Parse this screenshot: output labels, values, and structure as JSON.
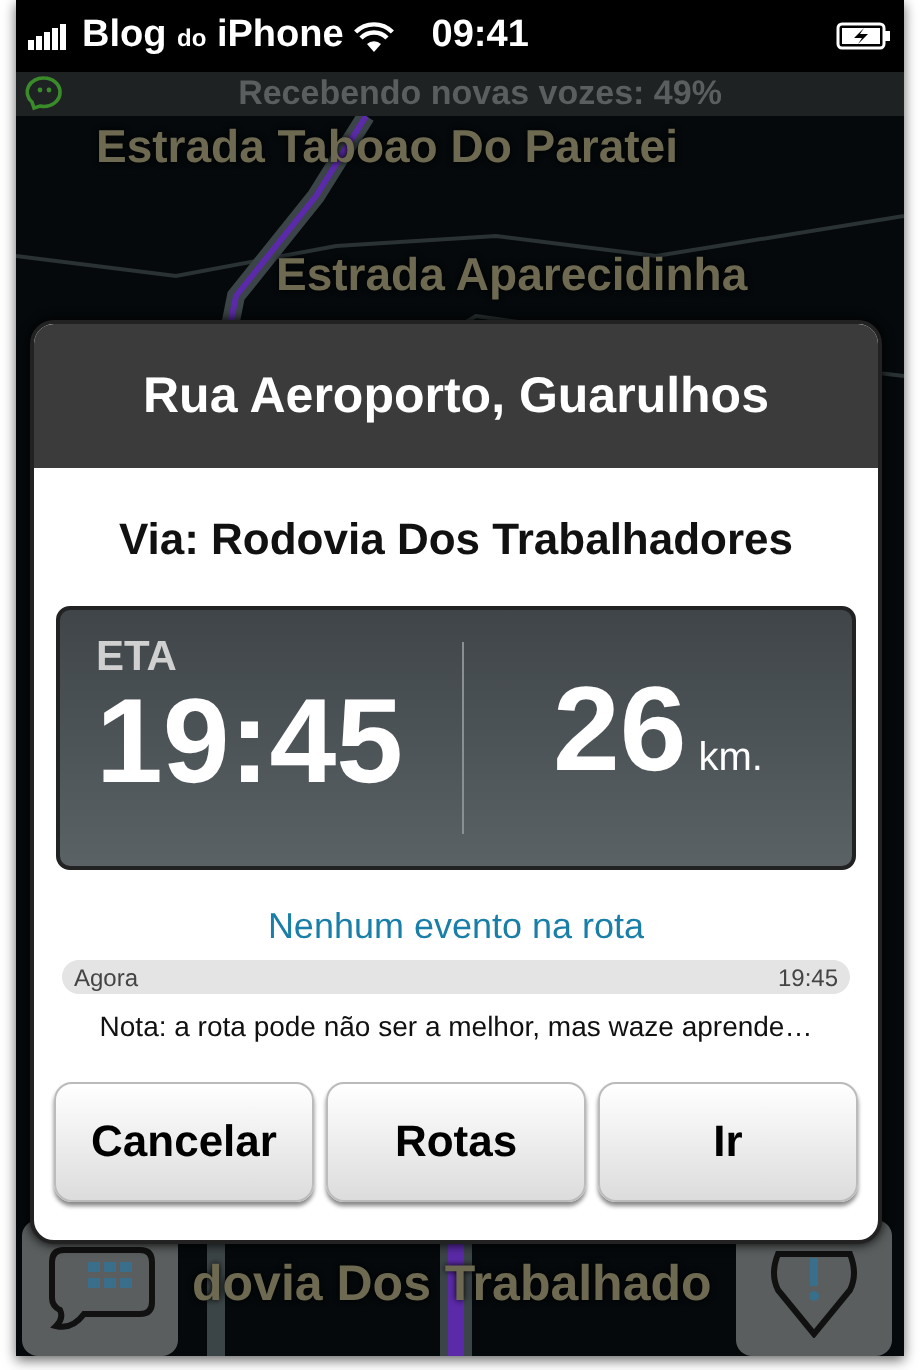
{
  "status_bar": {
    "carrier": "Blog",
    "carrier_suffix": "do",
    "carrier_name": "iPhone",
    "time": "09:41"
  },
  "banner": {
    "text": "Recebendo novas vozes: 49%"
  },
  "map": {
    "labels": [
      {
        "text": "Estrada Taboao Do Paratei"
      },
      {
        "text": "Estrada Aparecidinha"
      },
      {
        "text": "dovia Dos Trabalhado"
      }
    ]
  },
  "dialog": {
    "title": "Rua Aeroporto, Guarulhos",
    "via": "Via: Rodovia Dos Trabalhadores",
    "eta_label": "ETA",
    "eta_time": "19:45",
    "distance": "26",
    "distance_unit": "km.",
    "events": "Nenhum evento na rota",
    "timeline_start": "Agora",
    "timeline_end": "19:45",
    "note": "Nota: a rota pode não ser a melhor, mas waze aprende…",
    "buttons": [
      "Cancelar",
      "Rotas",
      "Ir"
    ]
  }
}
